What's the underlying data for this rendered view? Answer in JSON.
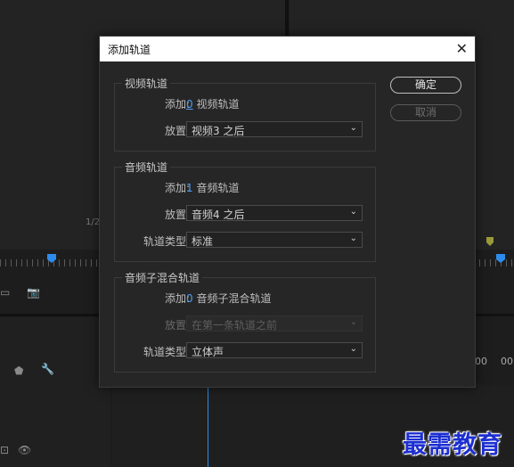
{
  "background": {
    "timecode_left": "1/2",
    "timecode_right_1": "00",
    "timecode_right_2": "00:"
  },
  "dialog": {
    "title": "添加轨道",
    "ok_label": "确定",
    "cancel_label": "取消",
    "video_group": {
      "title": "视频轨道",
      "add_label": "添加:",
      "add_count": "0",
      "add_suffix": "视频轨道",
      "placement_label": "放置:",
      "placement_value": "视频3 之后"
    },
    "audio_group": {
      "title": "音频轨道",
      "add_label": "添加:",
      "add_count": "1",
      "add_suffix": "音频轨道",
      "placement_label": "放置:",
      "placement_value": "音频4 之后",
      "track_type_label": "轨道类型:",
      "track_type_value": "标准"
    },
    "submix_group": {
      "title": "音频子混合轨道",
      "add_label": "添加:",
      "add_count": "0",
      "add_suffix": "音频子混合轨道",
      "placement_label": "放置:",
      "placement_value": "在第一条轨道之前",
      "track_type_label": "轨道类型:",
      "track_type_value": "立体声"
    }
  },
  "watermark": "最需教育"
}
